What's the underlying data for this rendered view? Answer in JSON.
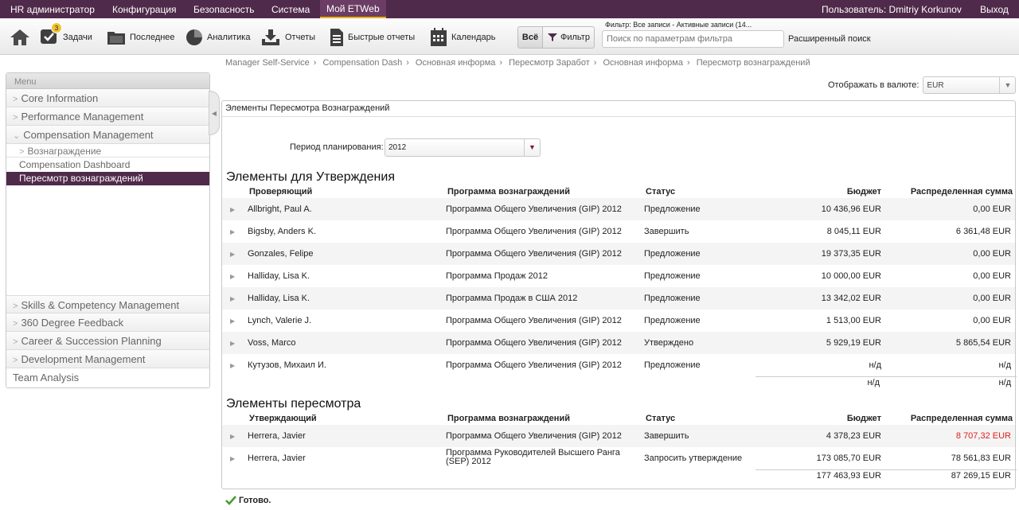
{
  "nav": {
    "items": [
      "HR администратор",
      "Конфигурация",
      "Безопасность",
      "Система",
      "Мой ETWeb"
    ],
    "user": "Пользователь: Dmitriy Korkunov",
    "logout": "Выход"
  },
  "toolbar": {
    "tasks": "Задачи",
    "tasks_badge": "3",
    "recent": "Последнее",
    "analytics": "Аналитика",
    "reports": "Отчеты",
    "quick_reports": "Быстрые отчеты",
    "calendar": "Календарь",
    "all": "Всё",
    "filter": "Фильтр",
    "filter_label": "Фильтр: Все записи - Активные записи (14...",
    "filter_placeholder": "Поиск по параметрам фильтра",
    "advanced": "Расширенный поиск"
  },
  "breadcrumb": [
    "Manager Self-Service",
    "Compensation Dash",
    "Основная информа",
    "Пересмотр Заработ",
    "Основная информа",
    "Пересмотр вознаграждений"
  ],
  "currency": {
    "label": "Отображать в валюте:",
    "value": "EUR"
  },
  "menu": {
    "title": "Menu",
    "top": [
      "Core Information",
      "Performance Management",
      "Compensation Management"
    ],
    "sub": "Вознаграждение",
    "dashboard": "Compensation Dashboard",
    "selected": "Пересмотр вознаграждений",
    "bottom": [
      "Skills & Competency Management",
      "360 Degree Feedback",
      "Career & Succession Planning",
      "Development Management"
    ],
    "team": "Team Analysis"
  },
  "panel": {
    "title": "Элементы Пересмотра Вознаграждений",
    "period_label": "Период планирования:",
    "period_value": "2012"
  },
  "approval": {
    "title": "Элементы для Утверждения",
    "headers": [
      "Проверяющий",
      "Программа вознаграждений",
      "Статус",
      "Бюджет",
      "Распределенная сумма"
    ],
    "rows": [
      [
        "Allbright, Paul A.",
        "Программа Общего Увеличения (GIP) 2012",
        "Предложение",
        "10 436,96 EUR",
        "0,00 EUR"
      ],
      [
        "Bigsby, Anders K.",
        "Программа Общего Увеличения (GIP) 2012",
        "Завершить",
        "8 045,11 EUR",
        "6 361,48 EUR"
      ],
      [
        "Gonzales, Felipe",
        "Программа Общего Увеличения (GIP) 2012",
        "Предложение",
        "19 373,35 EUR",
        "0,00 EUR"
      ],
      [
        "Halliday, Lisa K.",
        "Программа Продаж 2012",
        "Предложение",
        "10 000,00 EUR",
        "0,00 EUR"
      ],
      [
        "Halliday, Lisa K.",
        "Программа Продаж в США 2012",
        "Предложение",
        "13 342,02 EUR",
        "0,00 EUR"
      ],
      [
        "Lynch, Valerie J.",
        "Программа Общего Увеличения (GIP) 2012",
        "Предложение",
        "1 513,00 EUR",
        "0,00 EUR"
      ],
      [
        "Voss, Marco",
        "Программа Общего Увеличения (GIP) 2012",
        "Утверждено",
        "5 929,19 EUR",
        "5 865,54 EUR"
      ],
      [
        "Кутузов, Михаил И.",
        "Программа Общего Увеличения (GIP) 2012",
        "Предложение",
        "н/д",
        "н/д"
      ]
    ],
    "total_budget": "н/д",
    "total_alloc": "н/д"
  },
  "review": {
    "title": "Элементы пересмотра",
    "headers": [
      "Утверждающий",
      "Программа вознаграждений",
      "Статус",
      "Бюджет",
      "Распределенная сумма"
    ],
    "rows": [
      [
        "Herrera, Javier",
        "Программа Общего Увеличения (GIP) 2012",
        "Завершить",
        "4 378,23 EUR",
        "8 707,32 EUR"
      ],
      [
        "Herrera, Javier",
        "Программа Руководителей Высшего Ранга (SEP) 2012",
        "Запросить утверждение",
        "173 085,70 EUR",
        "78 561,83 EUR"
      ]
    ],
    "total_budget": "177 463,93 EUR",
    "total_alloc": "87 269,15 EUR",
    "alert_color": "#e0201c"
  },
  "status": "Готово."
}
